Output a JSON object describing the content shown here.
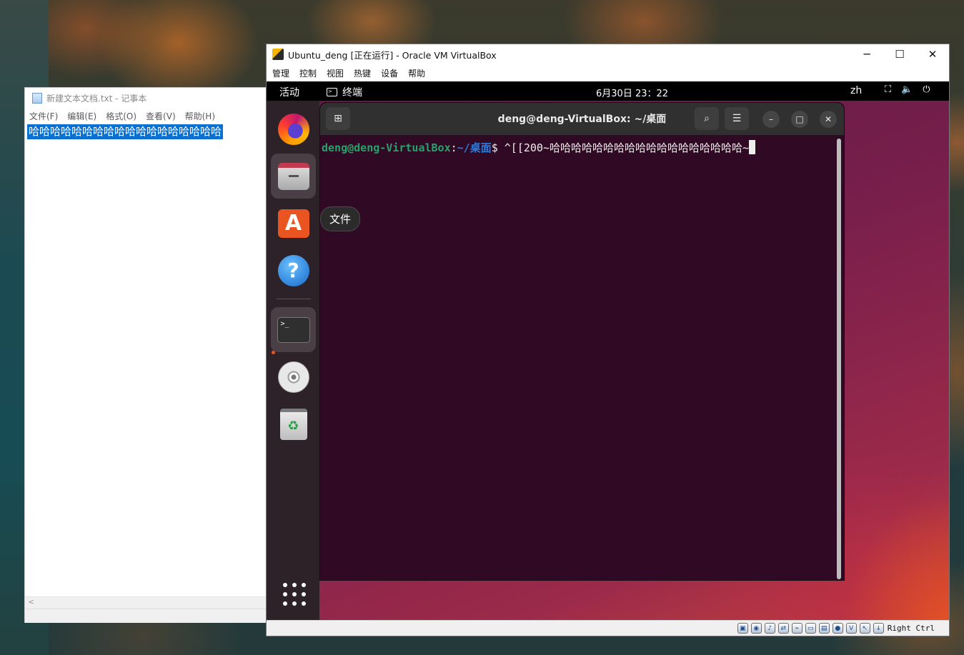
{
  "notepad": {
    "title": "新建文本文档.txt - 记事本",
    "menu": [
      "文件(F)",
      "编辑(E)",
      "格式(O)",
      "查看(V)",
      "帮助(H)"
    ],
    "content": "哈哈哈哈哈哈哈哈哈哈哈哈哈哈哈哈哈哈"
  },
  "vbox": {
    "title": "Ubuntu_deng [正在运行] - Oracle VM VirtualBox",
    "controls": {
      "minimize": "─",
      "maximize": "☐",
      "close": "✕"
    },
    "menu": [
      "管理",
      "控制",
      "视图",
      "热键",
      "设备",
      "帮助"
    ],
    "host_key": "Right Ctrl"
  },
  "guest": {
    "topbar": {
      "activities": "活动",
      "app": "终端",
      "clock": "6月30日 23：22",
      "lang": "zh"
    },
    "dock_tooltip": "文件",
    "terminal": {
      "title": "deng@deng-VirtualBox: ~/桌面",
      "prompt_user": "deng@deng-VirtualBox",
      "prompt_sep": ":",
      "prompt_path": "~/桌面",
      "prompt_symbol": "$ ",
      "command": "^[[200~哈哈哈哈哈哈哈哈哈哈哈哈哈哈哈哈哈哈~"
    }
  }
}
